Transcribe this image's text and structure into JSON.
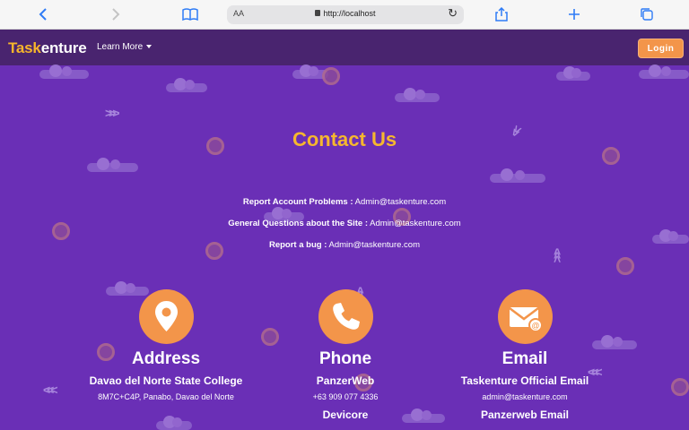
{
  "browser": {
    "text_size_label": "AA",
    "url": "http://localhost"
  },
  "nav": {
    "brand_part1": "Task",
    "brand_part2": "enture",
    "learn_more": "Learn More",
    "login": "Login"
  },
  "contact": {
    "heading": "Contact Us",
    "lines": [
      {
        "label": "Report Account Problems :",
        "value": "Admin@taskenture.com"
      },
      {
        "label": "General Questions about the Site :",
        "value": "Admin@taskenture.com"
      },
      {
        "label": "Report a bug :",
        "value": "Admin@taskenture.com"
      }
    ]
  },
  "cards": {
    "address": {
      "title": "Address",
      "line1": "Davao del Norte State College",
      "line2": "8M7C+C4P, Panabo, Davao del Norte"
    },
    "phone": {
      "title": "Phone",
      "line1": "PanzerWeb",
      "line2": "+63 909 077 4336",
      "line3": "Devicore"
    },
    "email": {
      "title": "Email",
      "line1": "Taskenture Official Email",
      "line2": "admin@taskenture.com",
      "line3": "Panzerweb Email"
    }
  },
  "colors": {
    "accent": "#f3954a",
    "heading": "#f6b72e",
    "background": "#6a2fb6",
    "navbar": "#49246f"
  }
}
